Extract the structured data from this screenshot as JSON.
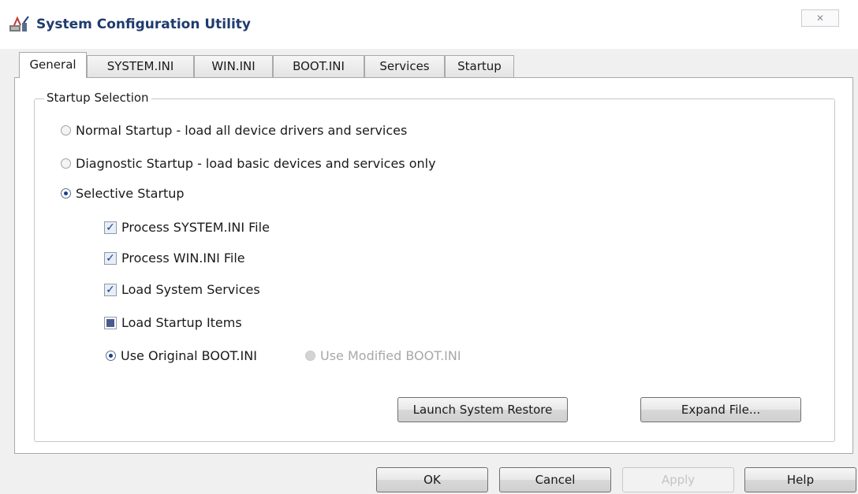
{
  "window": {
    "title": "System Configuration Utility",
    "close_glyph": "✕"
  },
  "tabs": [
    {
      "label": "General",
      "active": true
    },
    {
      "label": "SYSTEM.INI",
      "active": false
    },
    {
      "label": "WIN.INI",
      "active": false
    },
    {
      "label": "BOOT.INI",
      "active": false
    },
    {
      "label": "Services",
      "active": false
    },
    {
      "label": "Startup",
      "active": false
    }
  ],
  "startup_selection": {
    "group_label": "Startup Selection",
    "normal_label": "Normal Startup - load all device drivers and services",
    "diagnostic_label": "Diagnostic Startup - load basic devices and services only",
    "selective_label": "Selective Startup",
    "selected": "selective",
    "options": {
      "process_system_ini": {
        "label": "Process SYSTEM.INI File",
        "state": "checked"
      },
      "process_win_ini": {
        "label": "Process WIN.INI File",
        "state": "checked"
      },
      "load_system_services": {
        "label": "Load System Services",
        "state": "checked"
      },
      "load_startup_items": {
        "label": "Load Startup Items",
        "state": "indeterminate"
      }
    },
    "boot_ini": {
      "original_label": "Use Original BOOT.INI",
      "modified_label": "Use Modified BOOT.INI",
      "selected": "original"
    }
  },
  "panel_buttons": {
    "launch_restore": "Launch System Restore",
    "expand_file": "Expand File..."
  },
  "dialog_buttons": {
    "ok": "OK",
    "cancel": "Cancel",
    "apply": "Apply",
    "help": "Help"
  },
  "icons": {
    "app": "system-config-icon",
    "close": "close-icon",
    "check": "✓"
  },
  "colors": {
    "title_text": "#1f3b6e",
    "radio_dot": "#1b3f86",
    "disabled_text": "#a8a8a8"
  }
}
